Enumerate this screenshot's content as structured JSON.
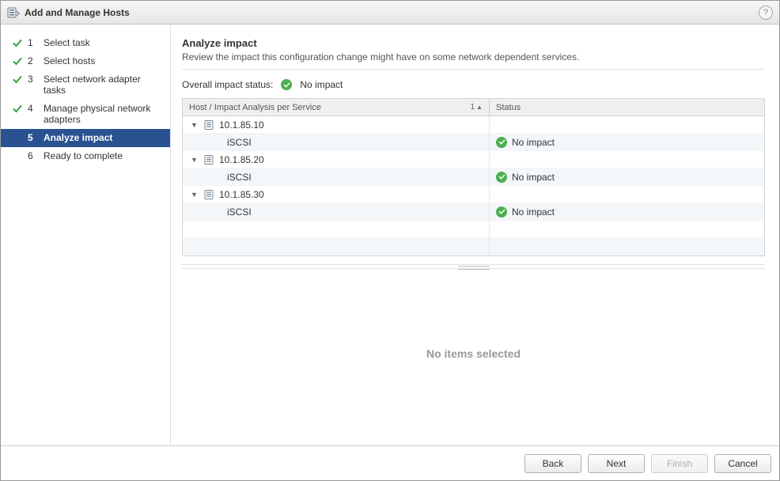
{
  "window": {
    "title": "Add and Manage Hosts"
  },
  "steps": [
    {
      "num": "1",
      "label": "Select task",
      "done": true,
      "active": false
    },
    {
      "num": "2",
      "label": "Select hosts",
      "done": true,
      "active": false
    },
    {
      "num": "3",
      "label": "Select network adapter tasks",
      "done": true,
      "active": false
    },
    {
      "num": "4",
      "label": "Manage physical network adapters",
      "done": true,
      "active": false
    },
    {
      "num": "5",
      "label": "Analyze impact",
      "done": false,
      "active": true
    },
    {
      "num": "6",
      "label": "Ready to complete",
      "done": false,
      "active": false
    }
  ],
  "page": {
    "heading": "Analyze impact",
    "description": "Review the impact this configuration change might have on some network dependent services."
  },
  "overall": {
    "label": "Overall impact status:",
    "status_text": "No impact"
  },
  "columns": {
    "c1": "Host / Impact Analysis per Service",
    "c2": "Status",
    "sort_col_index": "1"
  },
  "rows": [
    {
      "type": "host",
      "name": "10.1.85.10"
    },
    {
      "type": "service",
      "name": "iSCSI",
      "status": "No impact"
    },
    {
      "type": "host",
      "name": "10.1.85.20"
    },
    {
      "type": "service",
      "name": "iSCSI",
      "status": "No impact"
    },
    {
      "type": "host",
      "name": "10.1.85.30"
    },
    {
      "type": "service",
      "name": "iSCSI",
      "status": "No impact"
    }
  ],
  "detail": {
    "empty_text": "No items selected"
  },
  "buttons": {
    "back": "Back",
    "next": "Next",
    "finish": "Finish",
    "cancel": "Cancel"
  }
}
